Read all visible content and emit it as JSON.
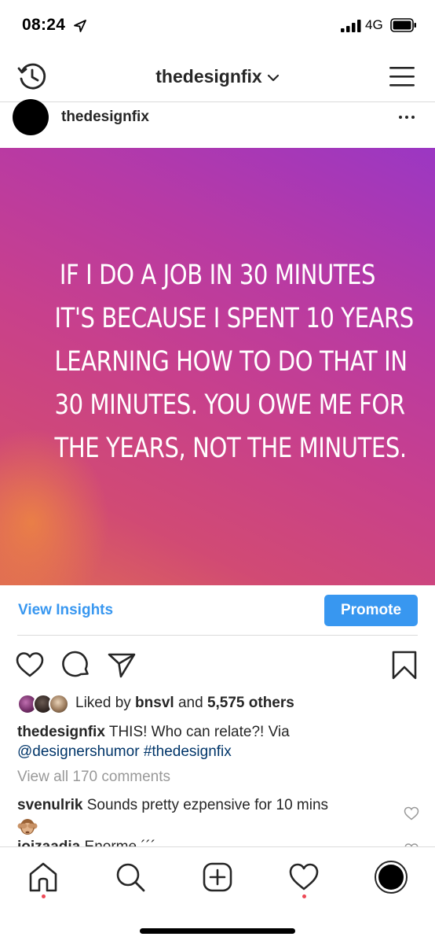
{
  "status_bar": {
    "time": "08:24",
    "network": "4G",
    "icons": [
      "location-arrow-icon",
      "signal-bars-icon",
      "battery-icon"
    ]
  },
  "top_nav": {
    "title": "thedesignfix",
    "icons": [
      "history-icon",
      "chevron-down-icon",
      "menu-icon"
    ]
  },
  "post": {
    "username": "thedesignfix",
    "image_text": [
      "IF I DO A JOB IN 30 MINUTES",
      "IT'S BECAUSE I SPENT 10 YEARS",
      "LEARNING HOW TO DO THAT IN",
      "30 MINUTES. YOU OWE ME FOR",
      "THE YEARS, NOT THE MINUTES."
    ],
    "image_gradient": [
      "#9b37c3",
      "#c8408c",
      "#de6a55"
    ]
  },
  "insights": {
    "view_insights": "View Insights",
    "promote": "Promote"
  },
  "actions": {
    "icons": [
      "heart-icon",
      "comment-icon",
      "share-icon",
      "bookmark-icon"
    ]
  },
  "likes": {
    "prefix": "Liked by ",
    "user": "bnsvl",
    "middle": " and ",
    "others": "5,575 others"
  },
  "caption": {
    "user": "thedesignfix",
    "text": " THIS! Who can relate?! Via ",
    "mention": "@designershumor",
    "space": " ",
    "hashtag": "#thedesignfix"
  },
  "comments": {
    "view_all": "View all 170 comments",
    "items": [
      {
        "user": "svenulrik",
        "text": " Sounds pretty ezpensive for 10 mins"
      },
      {
        "user": "joizaadia",
        "text": " Enorme ´´´"
      }
    ]
  },
  "tab_bar": {
    "tabs": [
      "home-icon",
      "search-icon",
      "add-icon",
      "activity-heart-icon",
      "profile-icon"
    ]
  },
  "colors": {
    "accent": "#3897f0",
    "text": "#262626",
    "muted": "#999999",
    "link": "#003569",
    "notification_dot": "#ed4956"
  }
}
